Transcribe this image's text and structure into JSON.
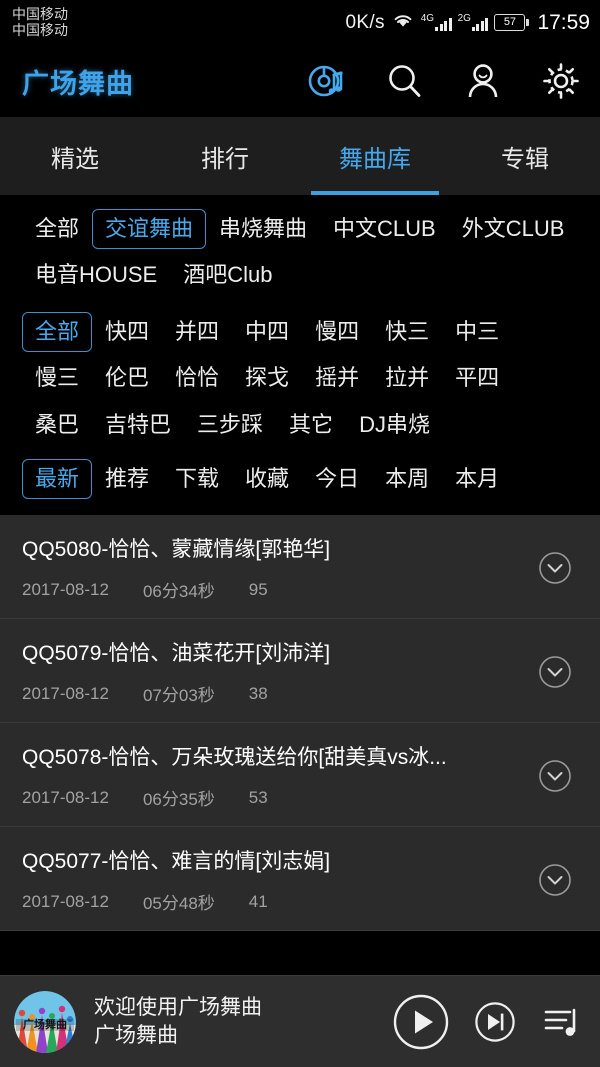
{
  "statusbar": {
    "carriers": [
      "中国移动",
      "中国移动"
    ],
    "net_speed": "0K/s",
    "wifi_icon": "wifi-icon",
    "sim1_label": "4G",
    "sim2_label": "2G",
    "battery_level": "57",
    "time": "17:59"
  },
  "appbar": {
    "title": "广场舞曲",
    "accent_color": "#3fa3ea",
    "actions": [
      {
        "name": "music-disc-icon"
      },
      {
        "name": "search-icon"
      },
      {
        "name": "user-icon"
      },
      {
        "name": "gear-icon"
      }
    ]
  },
  "tabs": [
    {
      "label": "精选",
      "active": false
    },
    {
      "label": "排行",
      "active": false
    },
    {
      "label": "舞曲库",
      "active": true
    },
    {
      "label": "专辑",
      "active": false
    }
  ],
  "filters": {
    "category": {
      "items": [
        "全部",
        "交谊舞曲",
        "串烧舞曲",
        "中文CLUB",
        "外文CLUB",
        "电音HOUSE",
        "酒吧Club"
      ],
      "selected": "交谊舞曲"
    },
    "style": {
      "items": [
        "全部",
        "快四",
        "并四",
        "中四",
        "慢四",
        "快三",
        "中三",
        "慢三",
        "伦巴",
        "恰恰",
        "探戈",
        "摇并",
        "拉并",
        "平四",
        "桑巴",
        "吉特巴",
        "三步踩",
        "其它",
        "DJ串烧"
      ],
      "selected": "全部"
    },
    "sort": {
      "items": [
        "最新",
        "推荐",
        "下载",
        "收藏",
        "今日",
        "本周",
        "本月"
      ],
      "selected": "最新"
    }
  },
  "list": {
    "expand_icon": "chevron-down-circle-icon",
    "rows": [
      {
        "title": "QQ5080-恰恰、蒙藏情缘[郭艳华]",
        "date": "2017-08-12",
        "duration": "06分34秒",
        "count": "95"
      },
      {
        "title": "QQ5079-恰恰、油菜花开[刘沛洋]",
        "date": "2017-08-12",
        "duration": "07分03秒",
        "count": "38"
      },
      {
        "title": "QQ5078-恰恰、万朵玫瑰送给你[甜美真vs冰...",
        "date": "2017-08-12",
        "duration": "06分35秒",
        "count": "53"
      },
      {
        "title": "QQ5077-恰恰、难言的情[刘志娟]",
        "date": "2017-08-12",
        "duration": "05分48秒",
        "count": "41"
      }
    ]
  },
  "player": {
    "album_art_label": "广场舞曲",
    "track_title": "欢迎使用广场舞曲",
    "track_artist": "广场舞曲",
    "play_icon": "play-icon",
    "next_icon": "skip-next-icon",
    "playlist_icon": "playlist-icon"
  }
}
